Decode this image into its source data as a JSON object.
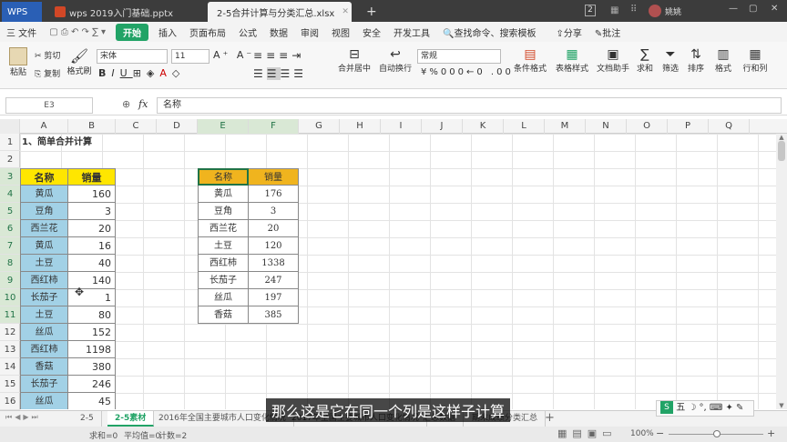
{
  "titlebar": {
    "app_tab": "WPS",
    "tab1": "wps 2019入门基础.pptx",
    "tab2": "2-5合并计算与分类汇总.xlsx",
    "new_tab": "+",
    "badge": "2",
    "user": "姚姚"
  },
  "menu": {
    "file": "三 文件",
    "start": "开始",
    "items": [
      "插入",
      "页面布局",
      "公式",
      "数据",
      "审阅",
      "视图",
      "安全",
      "开发工具"
    ],
    "search": "查找命令、搜索模板",
    "share": "分享",
    "comment": "批注"
  },
  "ribbon": {
    "cut": "剪切",
    "copy": "复制",
    "paste": "粘贴",
    "format_painter": "格式刷",
    "font_name": "宋体",
    "font_size": "11",
    "merge_center": "合并居中",
    "wrap": "自动换行",
    "number_format": "常规",
    "conditional": "条件格式",
    "table_style": "表格样式",
    "doc_helper": "文档助手",
    "sum": "求和",
    "filter": "筛选",
    "sort": "排序",
    "format": "格式",
    "rowcol": "行和列"
  },
  "formula_bar": {
    "name_box": "E3",
    "fx": "fx",
    "content": "名称"
  },
  "columns": [
    "A",
    "B",
    "C",
    "D",
    "E",
    "F",
    "G",
    "H",
    "I",
    "J",
    "K",
    "L",
    "M",
    "N",
    "O",
    "P",
    "Q"
  ],
  "rows": [
    "1",
    "2",
    "3",
    "4",
    "5",
    "6",
    "7",
    "8",
    "9",
    "10",
    "11",
    "12",
    "13",
    "14",
    "15",
    "16"
  ],
  "sheet": {
    "title": "1、简单合并计算",
    "left_headers": [
      "名称",
      "销量"
    ],
    "left_table": [
      [
        "黄瓜",
        "160"
      ],
      [
        "豆角",
        "3"
      ],
      [
        "西兰花",
        "20"
      ],
      [
        "黄瓜",
        "16"
      ],
      [
        "土豆",
        "40"
      ],
      [
        "西红柿",
        "140"
      ],
      [
        "长茄子",
        "1"
      ],
      [
        "土豆",
        "80"
      ],
      [
        "丝瓜",
        "152"
      ],
      [
        "西红柿",
        "1198"
      ],
      [
        "香菇",
        "380"
      ],
      [
        "长茄子",
        "246"
      ],
      [
        "丝瓜",
        "45"
      ]
    ],
    "right_headers": [
      "名称",
      "销量"
    ],
    "right_table": [
      [
        "黄瓜",
        "176"
      ],
      [
        "豆角",
        "3"
      ],
      [
        "西兰花",
        "20"
      ],
      [
        "土豆",
        "120"
      ],
      [
        "西红柿",
        "1338"
      ],
      [
        "长茄子",
        "247"
      ],
      [
        "丝瓜",
        "197"
      ],
      [
        "香菇",
        "385"
      ]
    ]
  },
  "sheet_tabs": [
    "2-5",
    "2-5素材",
    "2016年全国主要城市人口变化情况",
    "2017年全国主要城市人口变化情况",
    "汇总数据",
    "期末成绩分类汇总"
  ],
  "status": {
    "sum": "求和=0",
    "avg": "平均值=0",
    "count": "计数=2",
    "zoom": "100%"
  },
  "subtitle": "那么这是它在同一个列是这样子计算"
}
